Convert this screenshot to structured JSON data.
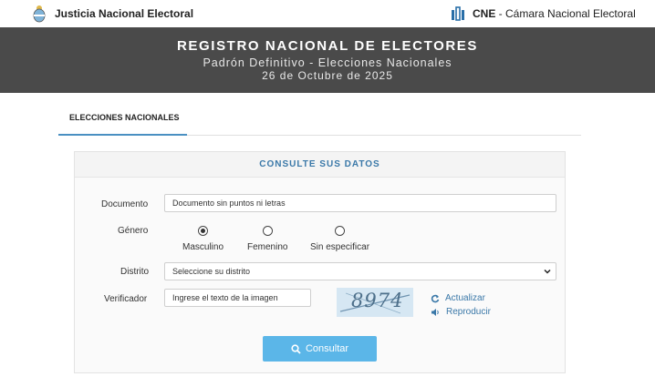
{
  "header": {
    "left_brand": "Justicia Nacional Electoral",
    "right_brand_bold": "CNE",
    "right_brand_rest": " - Cámara Nacional Electoral"
  },
  "hero": {
    "title": "REGISTRO NACIONAL DE ELECTORES",
    "subtitle": "Padrón Definitivo - Elecciones Nacionales",
    "date": "26 de Octubre de 2025"
  },
  "tabs": [
    {
      "label": "ELECCIONES NACIONALES",
      "active": true
    }
  ],
  "form": {
    "heading": "CONSULTE SUS DATOS",
    "documento_label": "Documento",
    "documento_placeholder": "Documento sin puntos ni letras",
    "genero_label": "Género",
    "genero_options": [
      {
        "label": "Masculino",
        "checked": true
      },
      {
        "label": "Femenino",
        "checked": false
      },
      {
        "label": "Sin especificar",
        "checked": false
      }
    ],
    "distrito_label": "Distrito",
    "distrito_selected": "Seleccione su distrito",
    "verificador_label": "Verificador",
    "verificador_placeholder": "Ingrese el texto de la imagen",
    "captcha_text": "8974",
    "actualizar_label": "Actualizar",
    "reproducir_label": "Reproducir",
    "submit_label": "Consultar"
  },
  "colors": {
    "accent": "#3a78a8",
    "button": "#5bb6e8",
    "hero_bg": "#4a4a4a"
  }
}
